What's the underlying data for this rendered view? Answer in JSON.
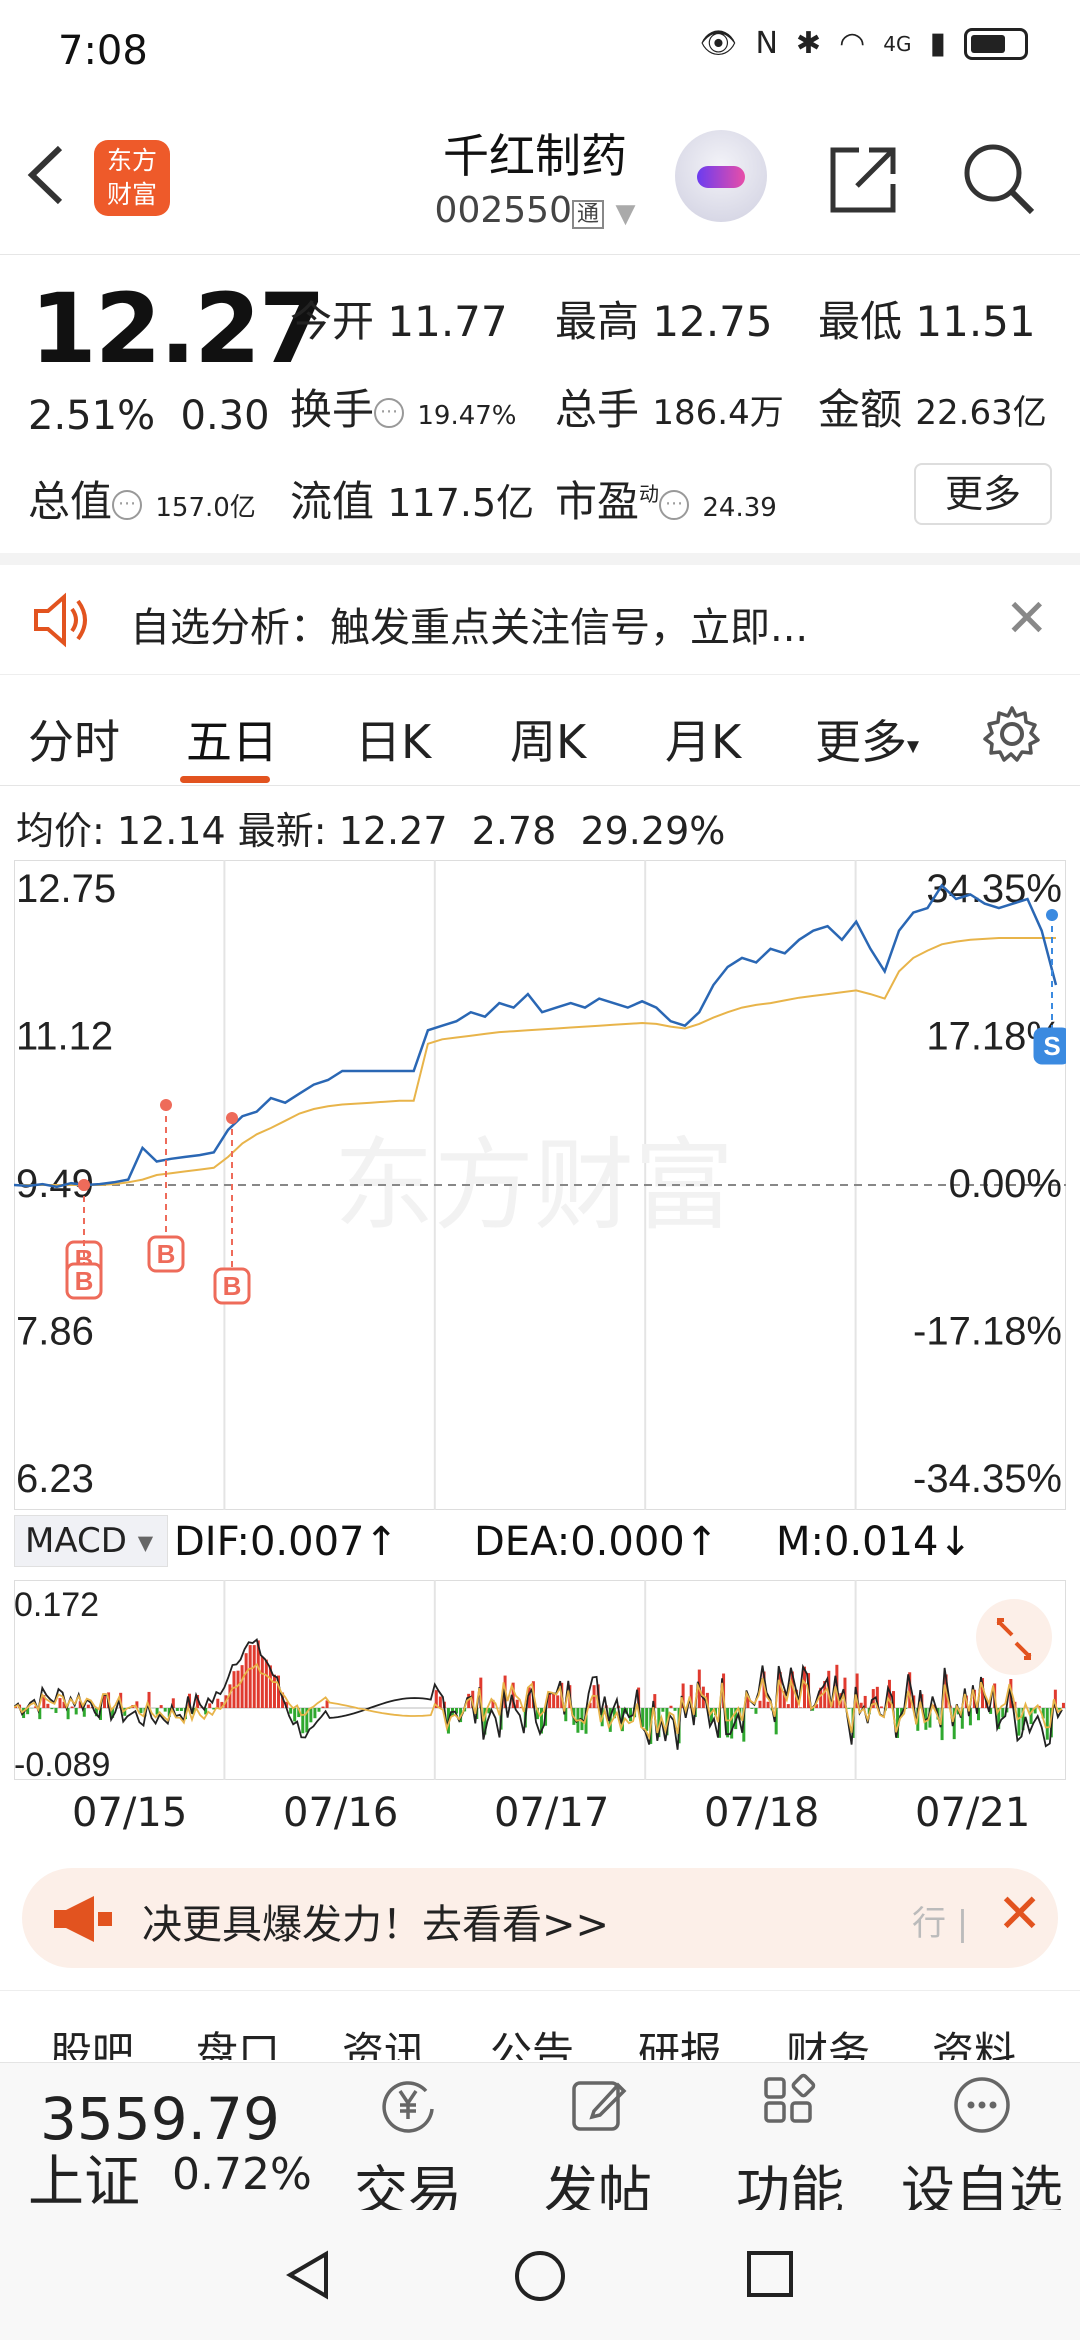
{
  "status": {
    "time": "7:08",
    "network": "4G"
  },
  "header": {
    "back_label": "<",
    "logo_text_1": "东方",
    "logo_text_2": "财富",
    "stock_name": "千红制药",
    "stock_code": "002550",
    "code_tag": "通"
  },
  "quote": {
    "price": "12.27",
    "change_pct": "2.51%",
    "change_amt": "0.30",
    "open_label": "今开",
    "open": "11.77",
    "high_label": "最高",
    "high": "12.75",
    "low_label": "最低",
    "low": "11.51",
    "turnover_label": "换手",
    "turnover": "19.47%",
    "volume_label": "总手",
    "volume": "186.4万",
    "amount_label": "金额",
    "amount": "22.63亿",
    "mktcap_label": "总值",
    "mktcap": "157.0亿",
    "float_label": "流值",
    "float": "117.5亿",
    "pe_label": "市盈",
    "pe_sup": "动",
    "pe": "24.39",
    "more": "更多"
  },
  "alert": {
    "text": "自选分析：触发重点关注信号，立即..."
  },
  "tabs": {
    "items": [
      "分时",
      "五日",
      "日K",
      "周K",
      "月K",
      "更多"
    ],
    "active": "五日"
  },
  "stats": {
    "avg_label": "均价:",
    "avg": "12.14",
    "latest_label": "最新:",
    "latest": "12.27",
    "chg": "2.78",
    "pct": "29.29%"
  },
  "chart_data": {
    "type": "line",
    "y_left_ticks": [
      "12.75",
      "11.12",
      "9.49",
      "7.86",
      "6.23"
    ],
    "y_right_ticks": [
      "34.35%",
      "17.18%",
      "0.00%",
      "-17.18%",
      "-34.35%"
    ],
    "ylim": [
      6.23,
      12.75
    ],
    "base_price": 9.49,
    "x_labels": [
      "07/15",
      "07/16",
      "07/17",
      "07/18",
      "07/21"
    ],
    "watermark": "东方财富",
    "series": [
      {
        "values": [
          9.49,
          9.48,
          9.5,
          9.47,
          9.51,
          9.49,
          9.5,
          9.52,
          9.55,
          9.9,
          9.75,
          9.78,
          9.8,
          9.82,
          9.85,
          10.1,
          10.25,
          10.3,
          10.45,
          10.4,
          10.5,
          10.6,
          10.65,
          10.75,
          10.75,
          10.75,
          10.75,
          10.75,
          10.75,
          11.2,
          11.25,
          11.3,
          11.4,
          11.35,
          11.5,
          11.45,
          11.6,
          11.4,
          11.45,
          11.5,
          11.45,
          11.55,
          11.5,
          11.45,
          11.52,
          11.45,
          11.3,
          11.25,
          11.4,
          11.7,
          11.9,
          12.0,
          11.95,
          12.1,
          12.05,
          12.2,
          12.3,
          12.35,
          12.2,
          12.4,
          12.1,
          11.85,
          12.3,
          12.5,
          12.55,
          12.8,
          12.65,
          12.7,
          12.6,
          12.55,
          12.6,
          12.65,
          12.3,
          11.7
        ]
      },
      {
        "values": [
          9.49,
          9.49,
          9.49,
          9.49,
          9.49,
          9.49,
          9.49,
          9.5,
          9.52,
          9.55,
          9.6,
          9.62,
          9.64,
          9.66,
          9.68,
          9.8,
          9.95,
          10.05,
          10.12,
          10.2,
          10.28,
          10.33,
          10.36,
          10.38,
          10.39,
          10.4,
          10.41,
          10.42,
          10.42,
          11.05,
          11.1,
          11.12,
          11.14,
          11.16,
          11.18,
          11.19,
          11.2,
          11.21,
          11.22,
          11.23,
          11.24,
          11.25,
          11.26,
          11.27,
          11.28,
          11.27,
          11.24,
          11.22,
          11.27,
          11.34,
          11.4,
          11.45,
          11.48,
          11.5,
          11.53,
          11.56,
          11.58,
          11.6,
          11.62,
          11.64,
          11.6,
          11.55,
          11.85,
          12.0,
          12.08,
          12.15,
          12.18,
          12.2,
          12.21,
          12.22,
          12.22,
          12.22,
          12.22,
          12.22
        ]
      }
    ],
    "markers": [
      "B",
      "B",
      "B",
      "S"
    ]
  },
  "macd": {
    "selector": "MACD",
    "dif": "DIF:0.007↑",
    "dea": "DEA:0.000↑",
    "m": "M:0.014↓",
    "top": "0.172",
    "bottom": "-0.089"
  },
  "promo": {
    "text": "决更具爆发力！去看看>>",
    "tail": "行"
  },
  "subtabs": [
    "股吧",
    "盘口",
    "资讯",
    "公告",
    "研报",
    "财务",
    "资料"
  ],
  "bottom": {
    "index_value": "3559.79",
    "index_name": "上证",
    "index_pct": "0.72%",
    "nav": [
      "交易",
      "发帖",
      "功能",
      "设自选"
    ]
  }
}
